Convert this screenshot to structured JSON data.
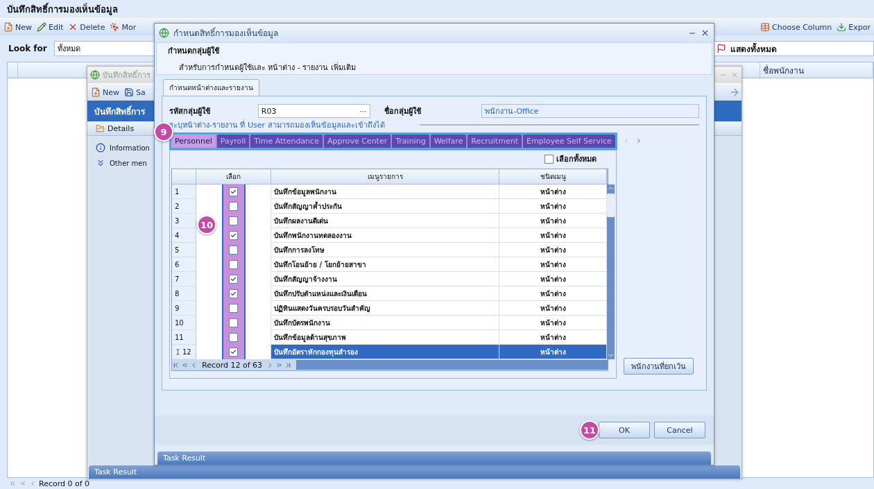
{
  "app": {
    "title": "บันทึกสิทธิ์การมองเห็นข้อมูล",
    "toolbar": [
      {
        "kind": "new",
        "label": "New"
      },
      {
        "kind": "edit",
        "label": "Edit"
      },
      {
        "kind": "delete",
        "label": "Delete"
      },
      {
        "kind": "more",
        "label": "Mor"
      }
    ],
    "toolbar_right": [
      {
        "kind": "columns",
        "label": "Choose Column"
      },
      {
        "kind": "export",
        "label": "Expor"
      }
    ],
    "look_for": {
      "label": "Look for",
      "value": "ทั้งหมด"
    },
    "filter": {
      "value": "แสดงทั้งหมด"
    },
    "grid": {
      "column_2": "ชื่อพนักงาน"
    },
    "pager": "Record 0 of 0"
  },
  "back_window": {
    "title": "บันทึกสิทธิ์การ",
    "toolbar": [
      {
        "kind": "new",
        "label": "New"
      },
      {
        "kind": "save",
        "label": "Sa"
      }
    ],
    "header": "บันทึกสิทธิ์การ",
    "section": "Details",
    "links": [
      {
        "kind": "info",
        "label": "Information"
      },
      {
        "kind": "more",
        "label": "Other men"
      }
    ],
    "task_bar": "Task Result"
  },
  "dialog": {
    "title": "กำหนดสิทธิ์การมองเห็นข้อมูล",
    "heading": "กำหนดกลุ่มผู้ใช้",
    "subheading": "สำหรับการกำหนดผู้ใช้และ หน้าต่าง - รายงาน เพิ่มเติม",
    "tabs": [
      {
        "label": "กำหนดหน้าต่างและรายงาน",
        "selected": true
      }
    ],
    "group_code": {
      "label": "รหัสกลุ่มผู้ใช้",
      "value": "R03",
      "button": "···"
    },
    "group_name": {
      "label": "ชื่อกลุ่มผู้ใช้",
      "value": "พนักงาน-Office"
    },
    "hint": "ระบุหน้าต่าง-รายงาน ที่ User สามารถมองเห็นข้อมูลและเข้าถึงได้",
    "module_tabs": [
      {
        "label": "Personnel",
        "selected": true
      },
      {
        "label": "Payroll",
        "selected": false
      },
      {
        "label": "Time Attendance",
        "selected": false
      },
      {
        "label": "Approve Center",
        "selected": false
      },
      {
        "label": "Training",
        "selected": false
      },
      {
        "label": "Welfare",
        "selected": false
      },
      {
        "label": "Recruitment",
        "selected": false
      },
      {
        "label": "Employee Self Service",
        "selected": false
      }
    ],
    "select_all": {
      "label": "เลือกทั้งหมด",
      "checked": false
    },
    "columns": [
      "เลือก",
      "เมนูรายการ",
      "ชนิดเมนู"
    ],
    "rows": [
      {
        "no": "1",
        "checked": true,
        "menu": "บันทึกข้อมูลพนักงาน",
        "type": "หน้าต่าง",
        "selected": false
      },
      {
        "no": "2",
        "checked": false,
        "menu": "บันทึกสัญญาค้ำประกัน",
        "type": "หน้าต่าง",
        "selected": false
      },
      {
        "no": "3",
        "checked": false,
        "menu": "บันทึกผลงานดีเด่น",
        "type": "หน้าต่าง",
        "selected": false
      },
      {
        "no": "4",
        "checked": true,
        "menu": "บันทึกพนักงานทดลองงาน",
        "type": "หน้าต่าง",
        "selected": false
      },
      {
        "no": "5",
        "checked": false,
        "menu": "บันทึกการลงโทษ",
        "type": "หน้าต่าง",
        "selected": false
      },
      {
        "no": "6",
        "checked": false,
        "menu": "บันทึกโอนย้าย / โยกย้ายสาขา",
        "type": "หน้าต่าง",
        "selected": false
      },
      {
        "no": "7",
        "checked": true,
        "menu": "บันทึกสัญญาจ้างงาน",
        "type": "หน้าต่าง",
        "selected": false
      },
      {
        "no": "8",
        "checked": true,
        "menu": "บันทึกปรับตำแหน่งและเงินเดือน",
        "type": "หน้าต่าง",
        "selected": false
      },
      {
        "no": "9",
        "checked": false,
        "menu": "ปฏิทินแสดงวันครบรอบวันสำคัญ",
        "type": "หน้าต่าง",
        "selected": false
      },
      {
        "no": "10",
        "checked": false,
        "menu": "บันทึกบัตรพนักงาน",
        "type": "หน้าต่าง",
        "selected": false
      },
      {
        "no": "11",
        "checked": false,
        "menu": "บันทึกข้อมูลด้านสุขภาพ",
        "type": "หน้าต่าง",
        "selected": false
      },
      {
        "no": "12",
        "checked": true,
        "menu": "บันทึกอัตราหักกองทุนสำรอง",
        "type": "หน้าต่าง",
        "selected": true
      }
    ],
    "pager": "Record 12 of 63",
    "exceptions_button": "พนักงานที่ยกเว้น",
    "buttons": [
      {
        "label": "OK"
      },
      {
        "label": "Cancel"
      }
    ],
    "task_bar": "Task Result"
  },
  "callouts": [
    {
      "label": "9"
    },
    {
      "label": "10"
    },
    {
      "label": "11"
    }
  ]
}
